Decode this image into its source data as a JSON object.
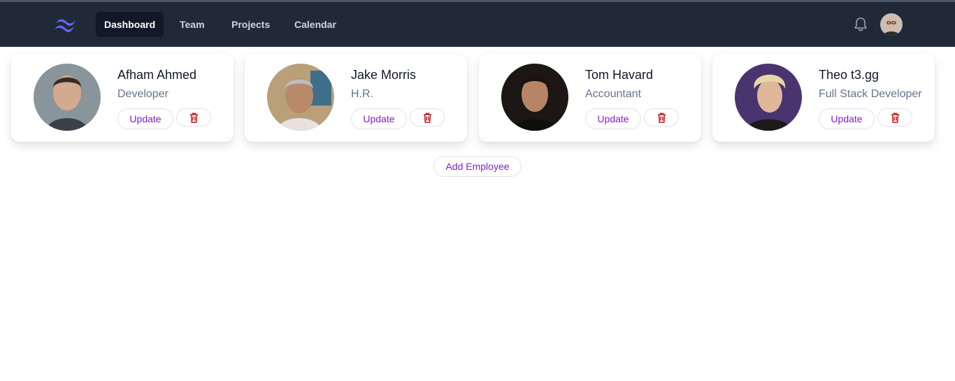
{
  "nav": {
    "items": [
      {
        "label": "Dashboard",
        "active": true
      },
      {
        "label": "Team",
        "active": false
      },
      {
        "label": "Projects",
        "active": false
      },
      {
        "label": "Calendar",
        "active": false
      }
    ],
    "icons": [
      "tailwind-logo-icon",
      "bell-icon",
      "user-avatar"
    ],
    "colors": {
      "bar": "#1f2937",
      "active_bg": "#111827",
      "logo": "#6366f1"
    }
  },
  "employees": [
    {
      "name": "Afham Ahmed",
      "role": "Developer",
      "update_label": "Update",
      "delete_icon": "trash-icon"
    },
    {
      "name": "Jake Morris",
      "role": "H.R.",
      "update_label": "Update",
      "delete_icon": "trash-icon"
    },
    {
      "name": "Tom Havard",
      "role": "Accountant",
      "update_label": "Update",
      "delete_icon": "trash-icon"
    },
    {
      "name": "Theo t3.gg",
      "role": "Full Stack Developer",
      "update_label": "Update",
      "delete_icon": "trash-icon"
    }
  ],
  "add_employee_label": "Add Employee",
  "colors": {
    "accent": "#7e22ce",
    "danger": "#b91c1c",
    "role_text": "#64748b"
  }
}
